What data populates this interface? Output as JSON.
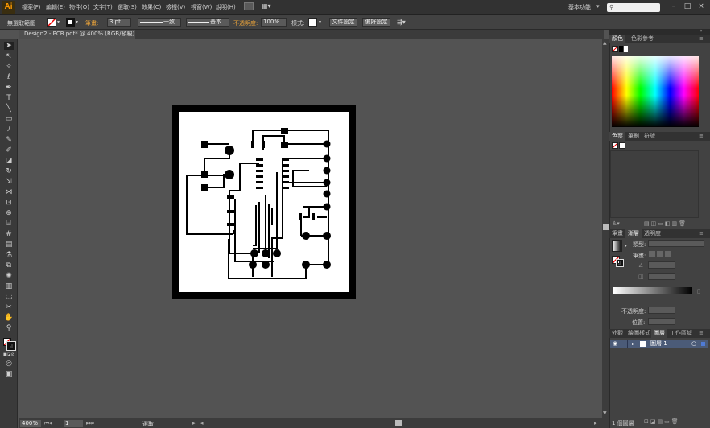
{
  "app": {
    "logo": "Ai"
  },
  "menu": {
    "items": [
      "檔案(F)",
      "編輯(E)",
      "物件(O)",
      "文字(T)",
      "選取(S)",
      "效果(C)",
      "檢視(V)",
      "視窗(W)",
      "說明(H)"
    ],
    "workspace_label": "基本功能",
    "search_placeholder": ""
  },
  "control_bar": {
    "selection_label": "無選取範圍",
    "stroke_label": "筆畫:",
    "stroke_weight": "3 pt",
    "profile_label": "一致",
    "brush_label": "基本",
    "opacity_label": "不透明度:",
    "opacity_value": "100%",
    "style_label": "樣式:",
    "doc_setup_button": "文件設定",
    "prefs_button": "偏好設定"
  },
  "document_tab": {
    "title": "Design2 - PCB.pdf* @ 400% (RGB/預視)"
  },
  "status_bar": {
    "zoom": "400%",
    "page": "1",
    "tool_info": "選取"
  },
  "panels": {
    "color_tabs": [
      "顏色",
      "色彩參考"
    ],
    "swatch_tabs": [
      "色票",
      "筆刷",
      "符號"
    ],
    "gradient_tabs": [
      "筆畫",
      "漸層",
      "透明度"
    ],
    "gradient_type_label": "類型:",
    "gradient_stroke_label": "筆畫:",
    "opacity_label": "不透明度:",
    "location_label": "位置:",
    "layer_tabs": [
      "外觀",
      "繪圖樣式",
      "圖層",
      "工作區域"
    ],
    "layer_name": "圖層 1",
    "layer_count": "1 個圖層"
  },
  "colors": {
    "ui_dark": "#323232",
    "panel": "#424242",
    "canvas": "#535353",
    "logo": "#ff9a00",
    "layer_highlight": "#4b5b78"
  }
}
